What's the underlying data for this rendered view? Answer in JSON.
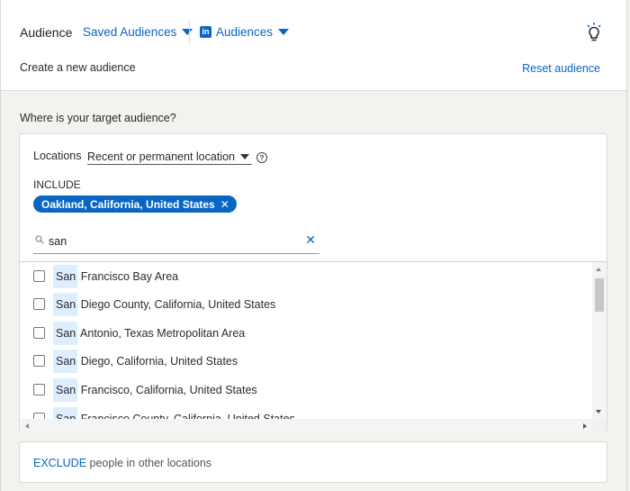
{
  "header": {
    "title": "Audience",
    "saved_audiences_label": "Saved Audiences",
    "linkedin_icon": "linkedin-icon",
    "audiences_label": "Audiences",
    "subtitle": "Create a new audience",
    "reset_label": "Reset audience",
    "bulb_icon": "lightbulb-icon"
  },
  "targeting": {
    "question": "Where is your target audience?",
    "locations_label": "Locations",
    "location_type": "Recent or permanent location",
    "include_label": "INCLUDE",
    "included_location": "Oakland, California, United States",
    "pill_remove": "✕",
    "search_value": "san",
    "search_clear": "✕",
    "results": [
      {
        "match": "San",
        "rest": " Francisco Bay Area"
      },
      {
        "match": "San",
        "rest": " Diego County, California, United States"
      },
      {
        "match": "San",
        "rest": " Antonio, Texas Metropolitan Area"
      },
      {
        "match": "San",
        "rest": " Diego, California, United States"
      },
      {
        "match": "San",
        "rest": " Francisco, California, United States"
      },
      {
        "match": "San",
        "rest": " Francisco County, California, United States"
      }
    ]
  },
  "exclude": {
    "link": "EXCLUDE",
    "text": " people in other locations"
  },
  "colors": {
    "accent": "#0a66c2",
    "highlight": "#ddeefe"
  }
}
